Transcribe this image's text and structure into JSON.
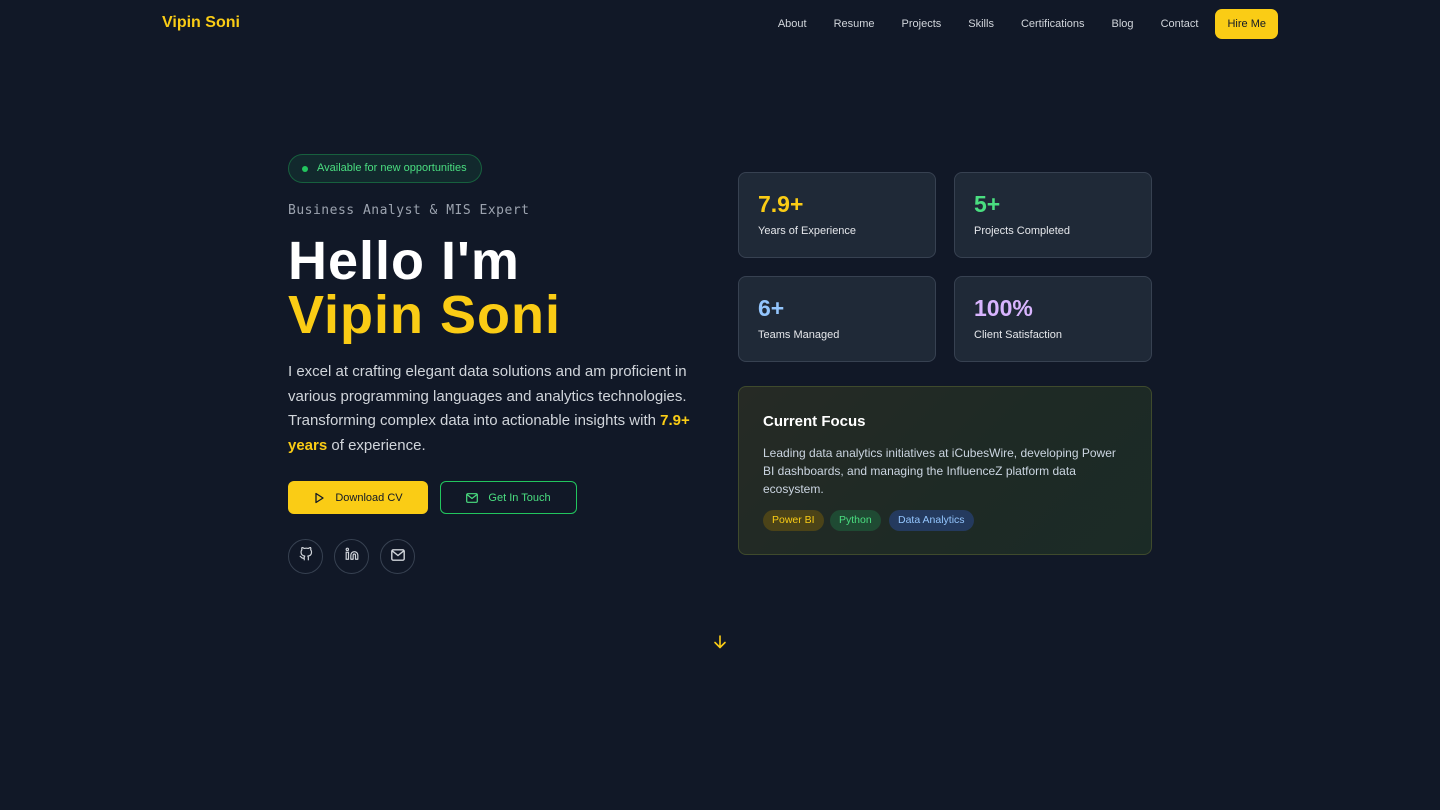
{
  "nav": {
    "logo": "Vipin Soni",
    "links": [
      "About",
      "Resume",
      "Projects",
      "Skills",
      "Certifications",
      "Blog",
      "Contact"
    ],
    "cta": "Hire Me"
  },
  "hero": {
    "badge": "Available for new opportunities",
    "subtitle": "Business Analyst & MIS Expert",
    "greeting": "Hello I'm",
    "name": "Vipin Soni",
    "intro_before": "I excel at crafting elegant data solutions and am proficient in various programming languages and analytics technologies. Transforming complex data into actionable insights with ",
    "intro_highlight": "7.9+ years",
    "intro_after": " of experience.",
    "download_label": "Download CV",
    "contact_label": "Get In Touch",
    "social_icons": [
      "github-icon",
      "linkedin-icon",
      "mail-icon"
    ]
  },
  "stats": [
    {
      "value": "7.9+",
      "label": "Years of Experience",
      "color": "#facc15"
    },
    {
      "value": "5+",
      "label": "Projects Completed",
      "color": "#4ade80"
    },
    {
      "value": "6+",
      "label": "Teams Managed",
      "color": "#93c5fd"
    },
    {
      "value": "100%",
      "label": "Client Satisfaction",
      "color": "#d8b4fe"
    }
  ],
  "focus": {
    "title": "Current Focus",
    "text": "Leading data analytics initiatives at iCubesWire, developing Power BI dashboards, and managing the InfluenceZ platform data ecosystem.",
    "tags": [
      "Power BI",
      "Python",
      "Data Analytics"
    ]
  },
  "colors": {
    "background": "#111827",
    "accent": "#facc15",
    "green": "#22c55e"
  }
}
